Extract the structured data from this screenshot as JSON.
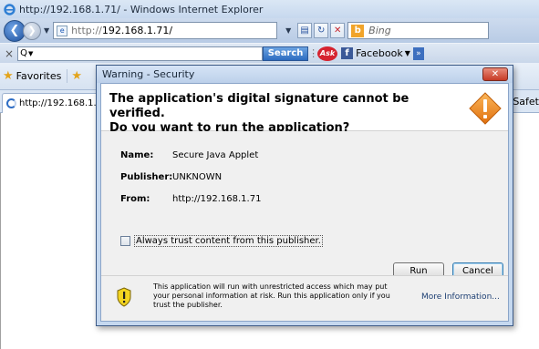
{
  "window": {
    "title": "http://192.168.1.71/ - Windows Internet Explorer"
  },
  "navbar": {
    "url_prefix": "http://",
    "url_host": "192.168.1.71/",
    "search_engine_placeholder": "Bing"
  },
  "search_toolbar": {
    "close_glyph": "×",
    "input_value": "Q",
    "search_label": "Search",
    "facebook_label": "Facebook"
  },
  "favorites_bar": {
    "favorites_label": "Favorites"
  },
  "tabs": {
    "active_tab_label": "http://192.168.1.7",
    "safety_label": "Safet"
  },
  "dialog": {
    "title": "Warning - Security",
    "heading_line1": "The application's digital signature cannot be verified.",
    "heading_line2": "Do you want to run the application?",
    "fields": [
      {
        "label": "Name:",
        "value": "Secure Java Applet"
      },
      {
        "label": "Publisher:",
        "value": "UNKNOWN"
      },
      {
        "label": "From:",
        "value": "http://192.168.1.71"
      }
    ],
    "checkbox_label": "Always trust content from this publisher.",
    "checkbox_checked": false,
    "run_label": "Run",
    "cancel_label": "Cancel",
    "footer_text": "This application will run with unrestricted access which may put your personal information at risk. Run this application only if you trust the publisher.",
    "more_info_label": "More Information..."
  },
  "colors": {
    "warning_orange": "#f08a1e",
    "shield_yellow": "#f3d420",
    "close_red": "#c63a25"
  }
}
